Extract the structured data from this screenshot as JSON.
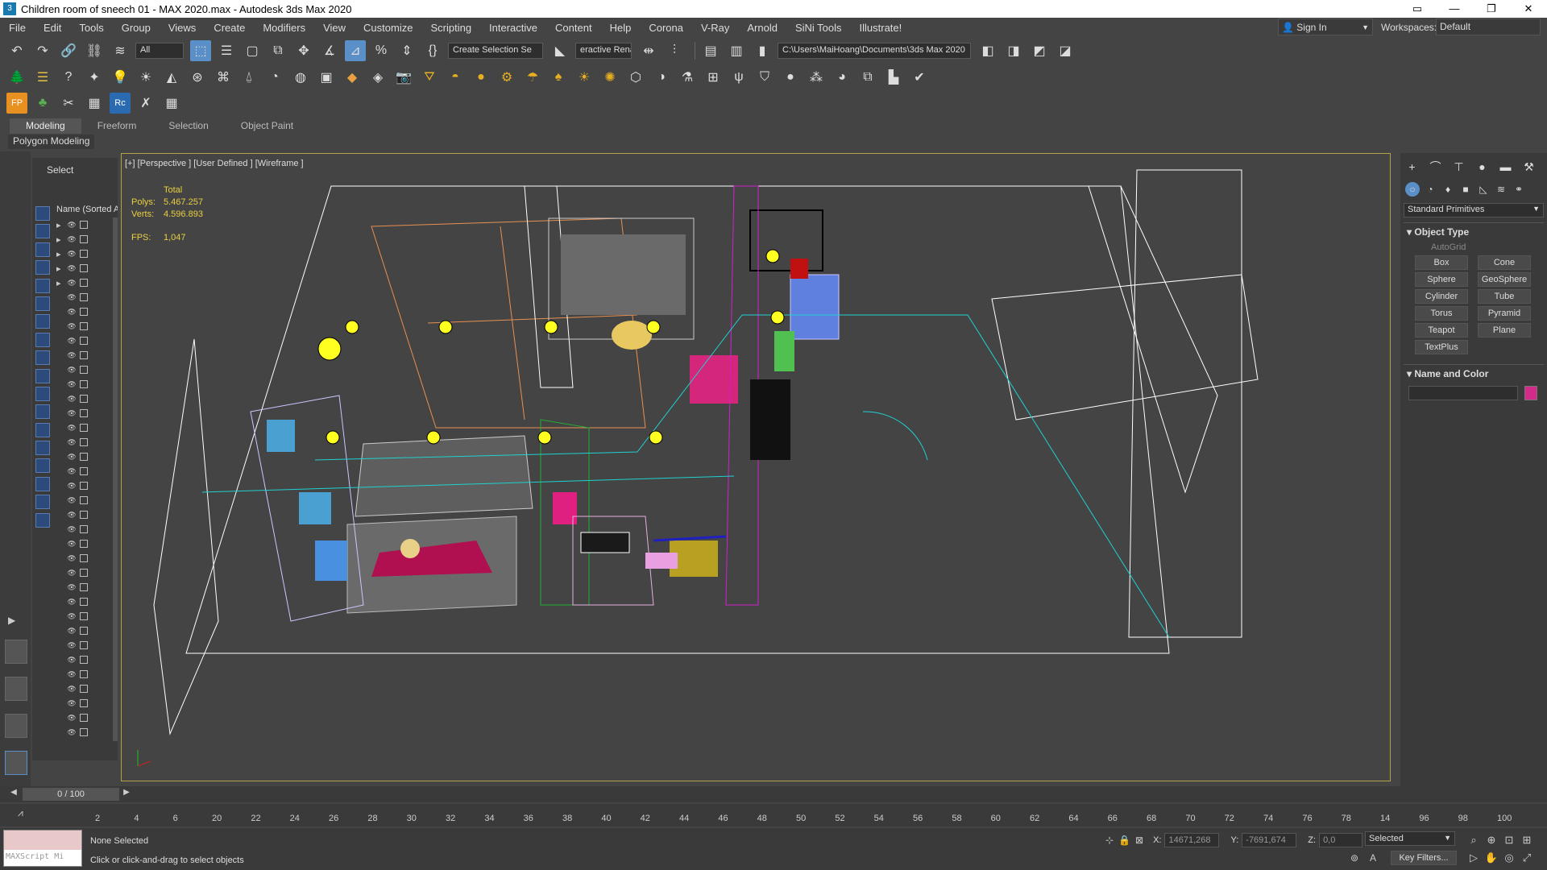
{
  "window": {
    "title": "Children room of sneech 01 - MAX 2020.max - Autodesk 3ds Max 2020",
    "app_icon": "3ds-max-icon",
    "controls": [
      "minimize-icon",
      "restore-icon",
      "close-icon"
    ]
  },
  "menu": {
    "items": [
      "File",
      "Edit",
      "Tools",
      "Group",
      "Views",
      "Create",
      "Modifiers",
      "View",
      "Customize",
      "Scripting",
      "Interactive",
      "Content",
      "Help",
      "Corona",
      "V-Ray",
      "Arnold",
      "SiNi Tools",
      "Illustrate!"
    ],
    "signin": "Sign In",
    "workspaces_label": "Workspaces:",
    "workspace_value": "Default"
  },
  "toolbar_main": {
    "filter_value": "All",
    "selection_set": "Create Selection Se",
    "render_label": "eractive Renai",
    "project_path": "C:\\Users\\MaiHoang\\Documents\\3ds Max 2020"
  },
  "ribbon": {
    "tabs": [
      "Modeling",
      "Freeform",
      "Selection",
      "Object Paint"
    ],
    "active_tab": "Modeling",
    "panel_label": "Polygon Modeling"
  },
  "scene_explorer": {
    "title": "Select",
    "column_header": "Name (Sorted A"
  },
  "viewport": {
    "label": "[+] [Perspective ] [User Defined ] [Wireframe ]",
    "stats": {
      "total_label": "Total",
      "polys_label": "Polys:",
      "polys_value": "5.467.257",
      "verts_label": "Verts:",
      "verts_value": "4.596.893",
      "fps_label": "FPS:",
      "fps_value": "1,047"
    }
  },
  "command_panel": {
    "category": "Standard Primitives",
    "object_type_header": "Object Type",
    "autogrid": "AutoGrid",
    "primitives": [
      "Box",
      "Cone",
      "Sphere",
      "GeoSphere",
      "Cylinder",
      "Tube",
      "Torus",
      "Pyramid",
      "Teapot",
      "Plane",
      "TextPlus"
    ],
    "name_color_header": "Name and Color",
    "color": "#d42a8a"
  },
  "timeline": {
    "frame": "0 / 100",
    "ticks": [
      "2",
      "4",
      "6",
      "20",
      "22",
      "24",
      "26",
      "28",
      "30",
      "32",
      "34",
      "36",
      "38",
      "40",
      "42",
      "44",
      "46",
      "48",
      "50",
      "52",
      "54",
      "56",
      "58",
      "60",
      "62",
      "64",
      "66",
      "68",
      "70",
      "72",
      "74",
      "76",
      "78",
      "14",
      "96",
      "98",
      "100"
    ]
  },
  "status": {
    "maxscript": "MAXScript Mi",
    "selection": "None Selected",
    "prompt": "Click or click-and-drag to select objects",
    "x_label": "X:",
    "x_value": "14671,268",
    "y_label": "Y:",
    "y_value": "-7691,674",
    "z_label": "Z:",
    "z_value": "0,0",
    "selected_dd": "Selected",
    "key_filters": "Key Filters..."
  }
}
